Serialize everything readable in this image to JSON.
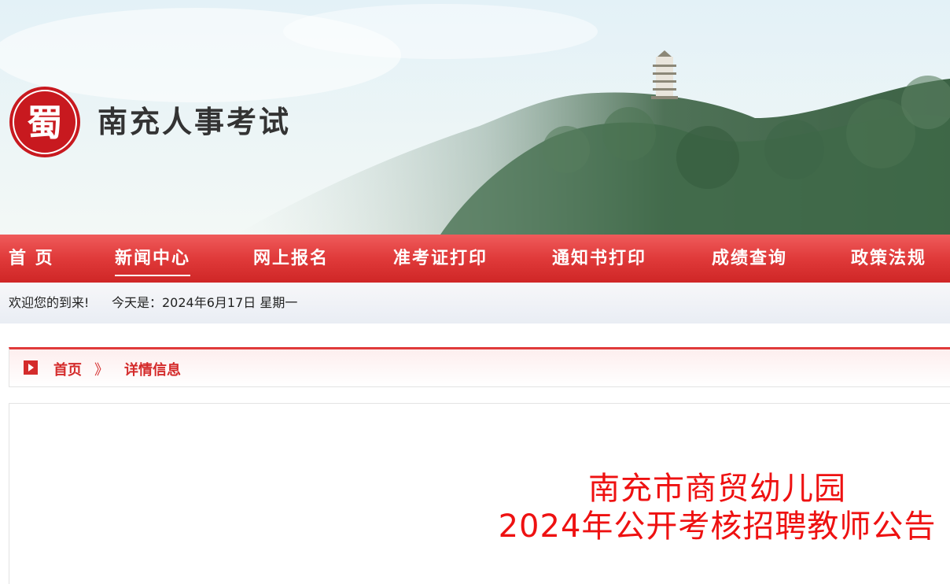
{
  "site": {
    "name": "南充人事考试",
    "logo_glyph": "蜀"
  },
  "nav": {
    "items": [
      {
        "label": "首  页"
      },
      {
        "label": "新闻中心",
        "active": true
      },
      {
        "label": "网上报名"
      },
      {
        "label": "准考证打印"
      },
      {
        "label": "通知书打印"
      },
      {
        "label": "成绩查询"
      },
      {
        "label": "政策法规"
      }
    ]
  },
  "welcome": {
    "greeting": "欢迎您的到来!",
    "date_text": "今天是：2024年6月17日 星期一"
  },
  "breadcrumb": {
    "home": "首页",
    "separator": "》",
    "current": "详情信息"
  },
  "article": {
    "title_line1": "南充市商贸幼儿园",
    "title_line2": "2024年公开考核招聘教师公告"
  },
  "colors": {
    "brand_red": "#e03a3a",
    "title_red": "#ee1111"
  }
}
